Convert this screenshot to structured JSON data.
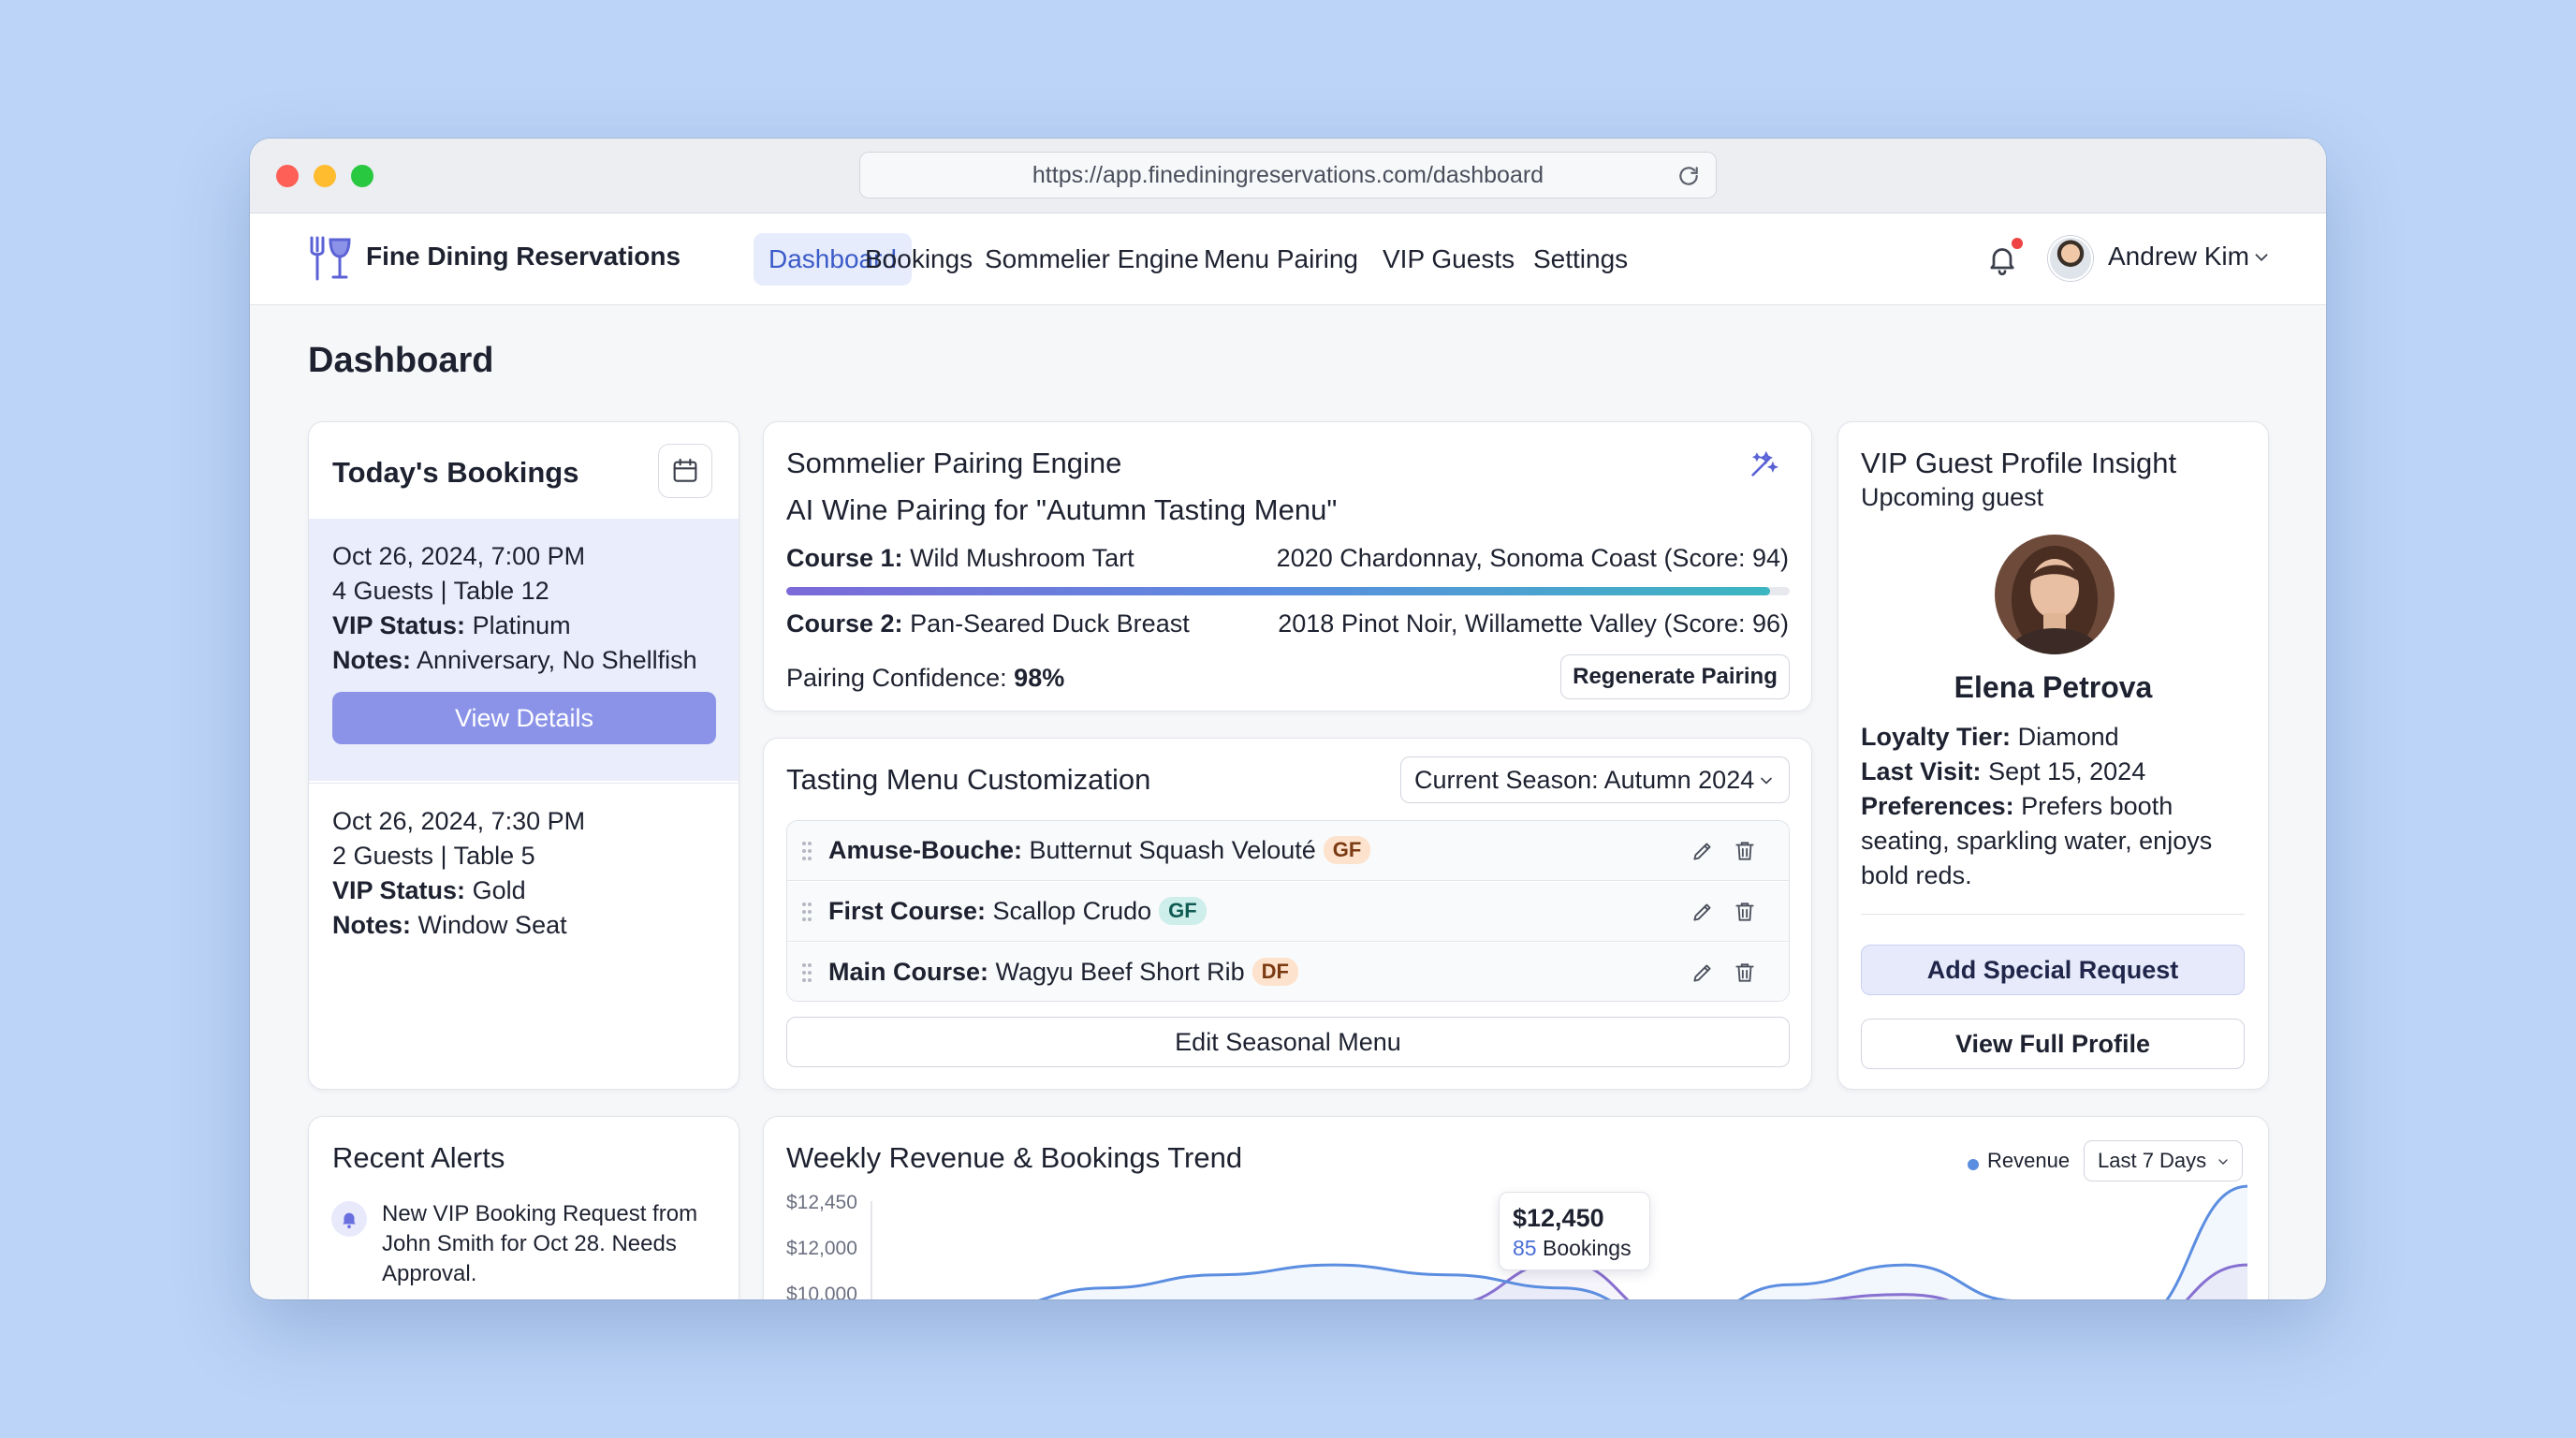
{
  "browser": {
    "url": "https://app.finediningreservations.com/dashboard"
  },
  "nav": {
    "brand": "Fine Dining Reservations",
    "items": [
      "Dashboard",
      "Bookings",
      "Sommelier Engine",
      "Menu Pairing",
      "VIP Guests",
      "Settings"
    ],
    "active": "Dashboard",
    "user_name": "Andrew Kim"
  },
  "page_title": "Dashboard",
  "todays_bookings": {
    "title": "Today's Bookings",
    "bookings": [
      {
        "datetime": "Oct 26, 2024, 7:00 PM",
        "guests_table": "4 Guests | Table 12",
        "vip_label": "VIP Status:",
        "vip_value": "Platinum",
        "notes_label": "Notes:",
        "notes_value": "Anniversary, No Shellfish",
        "button": "View Details"
      },
      {
        "datetime": "Oct 26, 2024, 7:30 PM",
        "guests_table": "2 Guests | Table 5",
        "vip_label": "VIP Status:",
        "vip_value": "Gold",
        "notes_label": "Notes:",
        "notes_value": "Window Seat"
      }
    ]
  },
  "sommelier": {
    "title": "Sommelier Pairing Engine",
    "subtitle": "AI Wine Pairing for \"Autumn Tasting Menu\"",
    "course1_label": "Course 1:",
    "course1_dish": "Wild Mushroom Tart",
    "course1_wine": "2020 Chardonnay, Sonoma Coast (Score: 94)",
    "course2_label": "Course 2:",
    "course2_dish": "Pan-Seared Duck Breast",
    "course2_wine": "2018 Pinot Noir, Willamette Valley (Score: 96)",
    "confidence_label": "Pairing Confidence:",
    "confidence_value": "98%",
    "confidence_fraction": 0.98,
    "button": "Regenerate Pairing"
  },
  "tasting_menu": {
    "title": "Tasting Menu Customization",
    "season_select": "Current Season: Autumn 2024",
    "courses": [
      {
        "label": "Amuse-Bouche:",
        "dish": "Butternut Squash Velouté",
        "tag": "GF",
        "tag_color": "orange"
      },
      {
        "label": "First Course:",
        "dish": "Scallop Crudo",
        "tag": "GF",
        "tag_color": "teal"
      },
      {
        "label": "Main Course:",
        "dish": "Wagyu Beef Short Rib",
        "tag": "DF",
        "tag_color": "orange"
      }
    ],
    "button": "Edit Seasonal Menu"
  },
  "vip": {
    "title": "VIP Guest Profile Insight",
    "subtitle": "Upcoming guest",
    "name": "Elena Petrova",
    "loyalty_label": "Loyalty Tier:",
    "loyalty_value": "Diamond",
    "last_visit_label": "Last Visit:",
    "last_visit_value": "Sept 15, 2024",
    "preferences_label": "Preferences:",
    "preferences_value": "Prefers booth seating, sparkling water, enjoys bold reds.",
    "add_request_button": "Add Special Request",
    "view_profile_button": "View Full Profile"
  },
  "alerts": {
    "title": "Recent Alerts",
    "items": [
      "New VIP Booking Request from John Smith for Oct 28. Needs Approval."
    ]
  },
  "revenue": {
    "title": "Weekly Revenue & Bookings Trend",
    "legend": "Revenue",
    "range": "Last 7 Days",
    "tooltip_value": "$12,450",
    "tooltip_bookings_num": "85",
    "tooltip_bookings_label": "Bookings"
  },
  "chart_data": {
    "type": "line",
    "title": "Weekly Revenue & Bookings Trend",
    "y_tick_labels": [
      "$12,450",
      "$12,000",
      "$10,000"
    ],
    "yticks": [
      12450,
      12000,
      11550
    ],
    "ylim": [
      11500,
      12500
    ],
    "x": [
      0,
      1,
      2,
      3,
      4,
      5,
      6,
      7,
      8,
      9,
      10,
      11,
      12
    ],
    "series": [
      {
        "name": "Revenue",
        "color": "#5b8de0",
        "values": [
          11550,
          11680,
          11800,
          11880,
          11940,
          11880,
          11800,
          11580,
          11820,
          11940,
          11720,
          11600,
          12420
        ]
      },
      {
        "name": "",
        "color": "#8a6fd0",
        "values": [
          11550,
          11600,
          11700,
          11720,
          11690,
          11700,
          11960,
          11600,
          11720,
          11760,
          11630,
          11560,
          11940
        ]
      }
    ],
    "highlight": {
      "x": 7,
      "value": 11550
    },
    "legend_position": "top-right",
    "grid": false
  }
}
